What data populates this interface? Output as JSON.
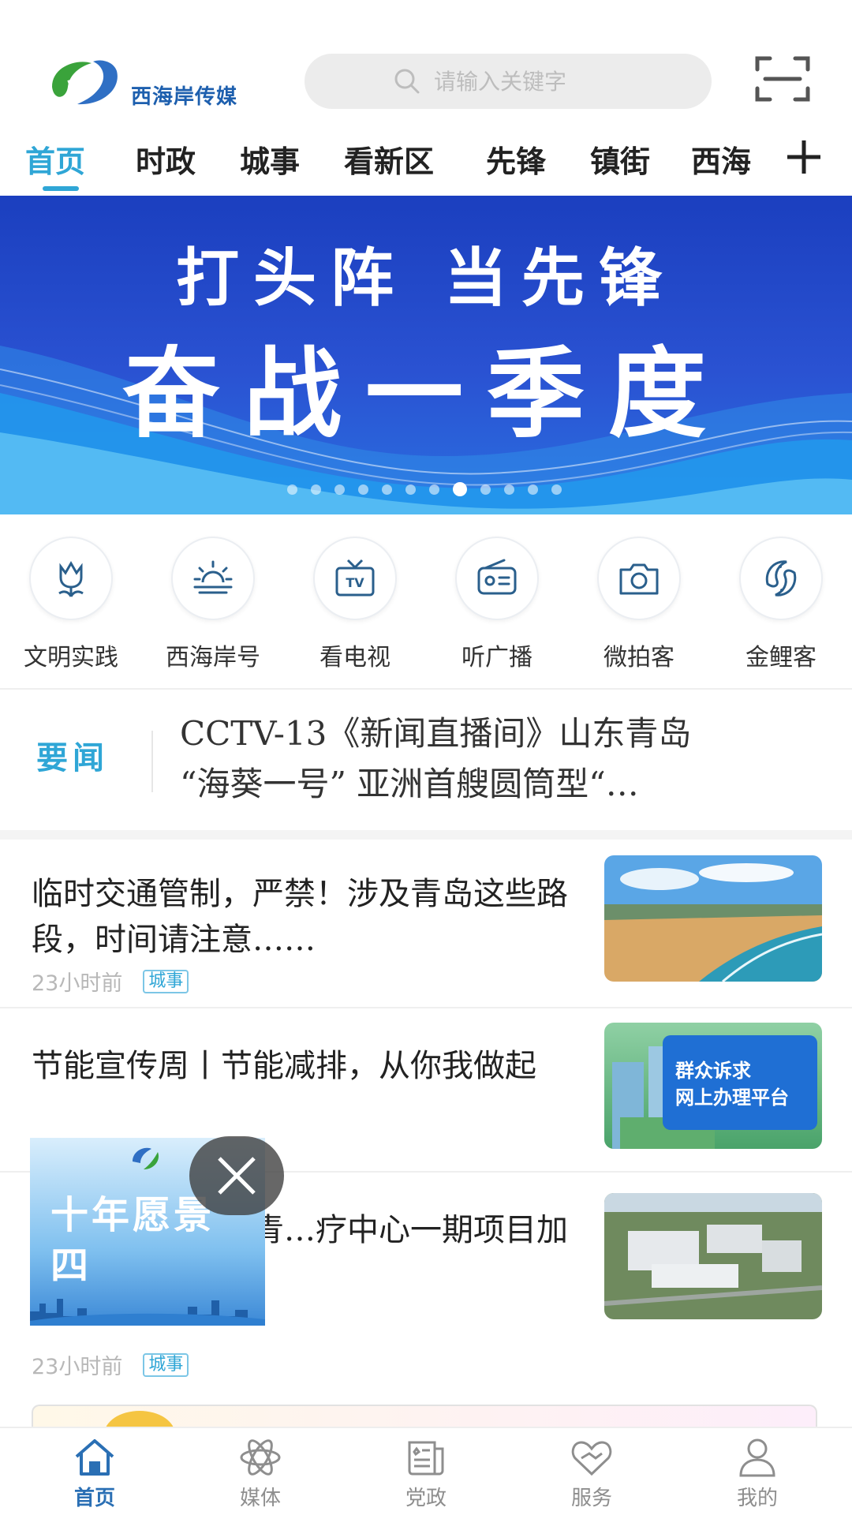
{
  "header": {
    "logo_text": "西海岸传媒",
    "search_placeholder": "请输入关键字"
  },
  "tabs": [
    "首页",
    "时政",
    "城事",
    "看新区",
    "先锋",
    "镇街",
    "西海"
  ],
  "banner": {
    "line1": "打头阵 当先锋",
    "line2": "奋战一季度",
    "dot_count": 12,
    "active_dot": 7
  },
  "quick_links": [
    {
      "label": "文明实践",
      "icon": "tulip-icon"
    },
    {
      "label": "西海岸号",
      "icon": "sunrise-icon"
    },
    {
      "label": "看电视",
      "icon": "tv-icon"
    },
    {
      "label": "听广播",
      "icon": "radio-icon"
    },
    {
      "label": "微拍客",
      "icon": "camera-icon"
    },
    {
      "label": "金鲤客",
      "icon": "carp-icon"
    }
  ],
  "headline": {
    "tag": "要闻",
    "line1": "CCTV-13《新闻直播间》山东青岛",
    "line2": "“海葵一号” 亚洲首艘圆筒型“…"
  },
  "news": [
    {
      "title": "临时交通管制，严禁！涉及青岛这些路段，时间请注意……",
      "time": "23小时前",
      "tag": "城事"
    },
    {
      "title": "节能宣传周丨节能减排，从你我做起",
      "time": "",
      "tag": "",
      "thumb_text": "群众诉求\n网上办理平台"
    },
    {
      "title": "合！西海岸新区青…疗中心一期项目加快建设",
      "time": "23小时前",
      "tag": "城事"
    }
  ],
  "news_thumb_text": {
    "line1": "群众诉求",
    "line2": "网上办理平台"
  },
  "float_ad": {
    "text": "十年愿景\n四"
  },
  "float_ad_lines": {
    "line1": "十年愿景",
    "line2": "四"
  },
  "bottom_nav": [
    {
      "label": "首页",
      "icon": "home-icon",
      "active": true
    },
    {
      "label": "媒体",
      "icon": "atom-icon",
      "active": false
    },
    {
      "label": "党政",
      "icon": "news-icon",
      "active": false
    },
    {
      "label": "服务",
      "icon": "heart-hands-icon",
      "active": false
    },
    {
      "label": "我的",
      "icon": "user-icon",
      "active": false
    }
  ],
  "colors": {
    "accent": "#2fa6d6",
    "banner": "#2a52d2",
    "nav_active": "#2a6fb4"
  }
}
